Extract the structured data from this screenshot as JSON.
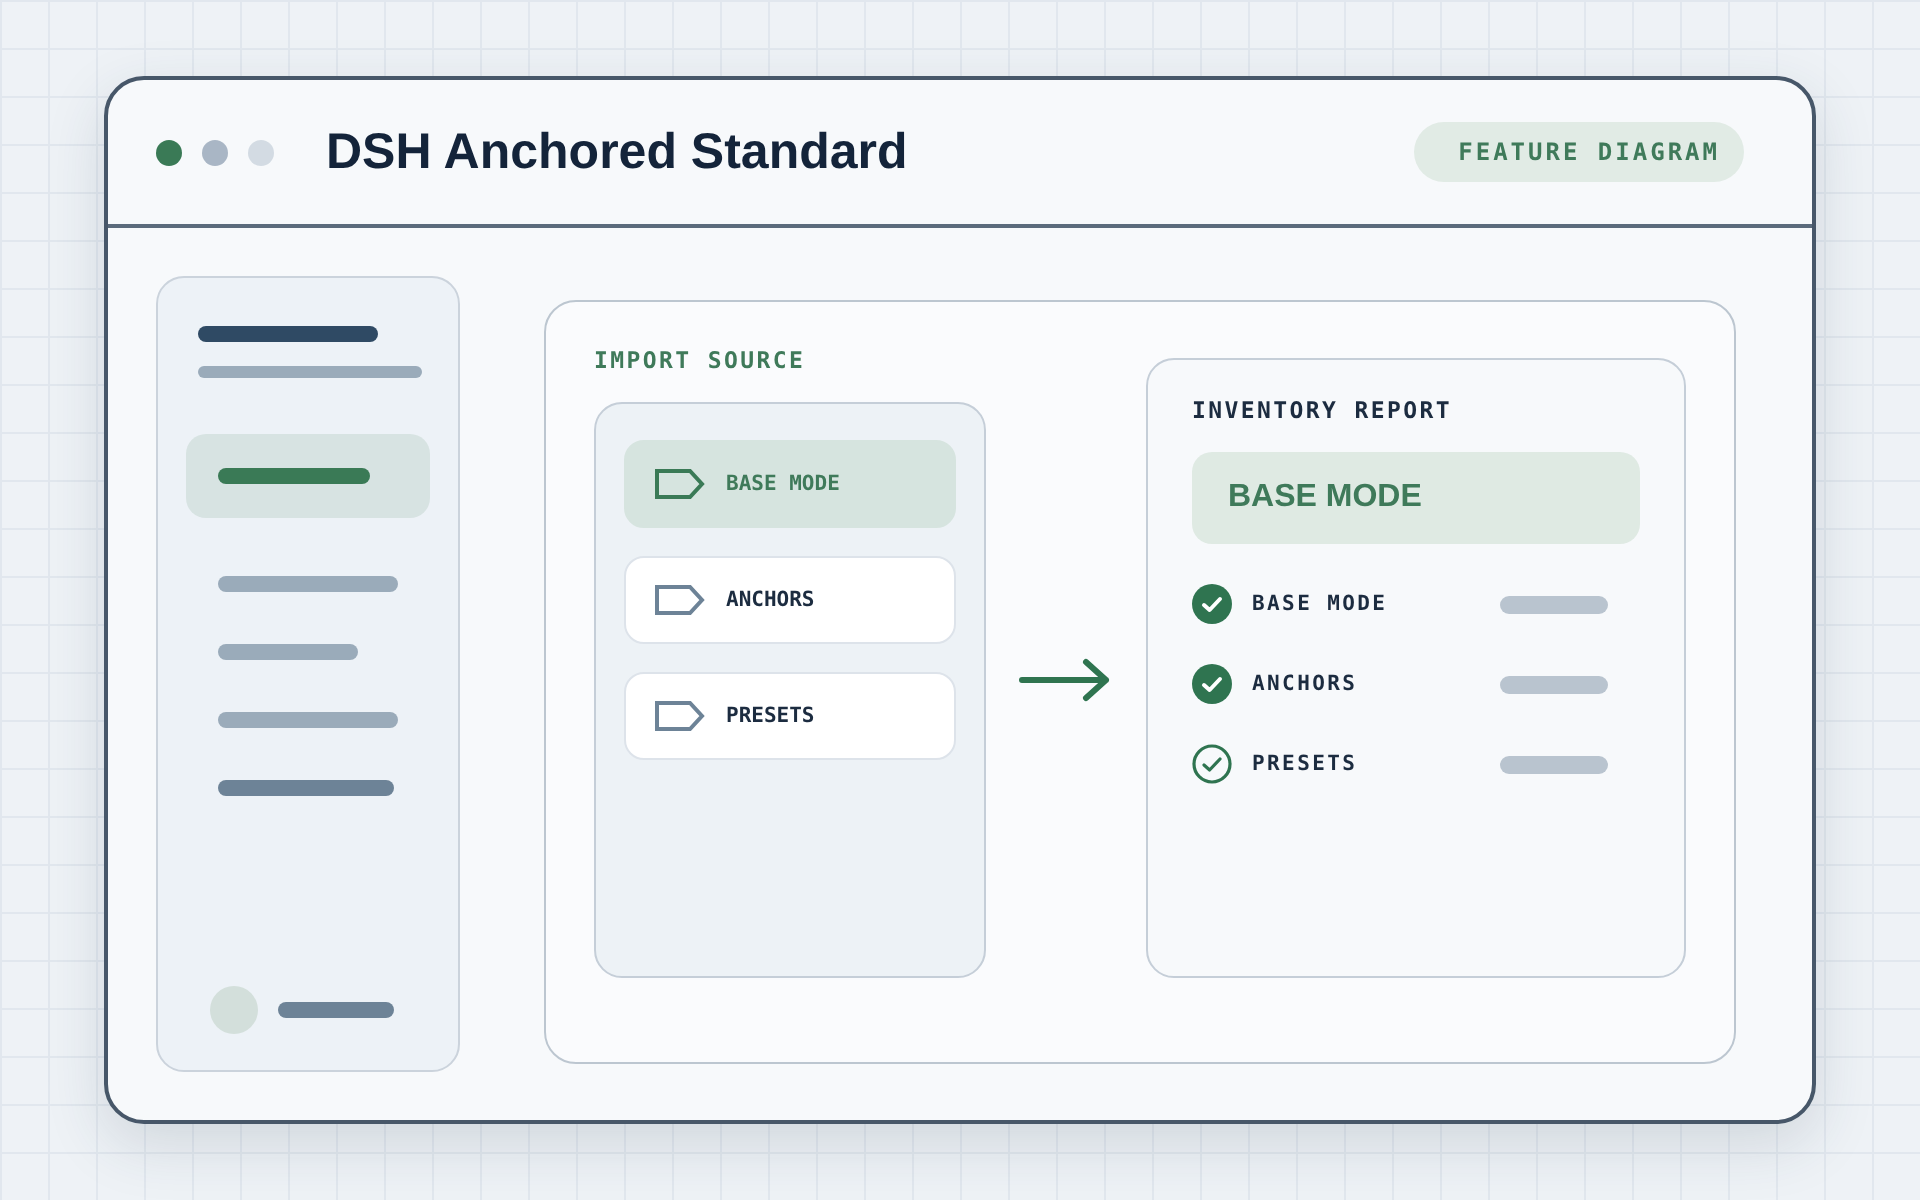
{
  "window": {
    "title": "DSH Anchored Standard",
    "badge": "FEATURE DIAGRAM"
  },
  "sidebar": {
    "items": [
      {
        "selected": true
      },
      {
        "selected": false
      },
      {
        "selected": false
      },
      {
        "selected": false
      },
      {
        "selected": false
      }
    ]
  },
  "import_source": {
    "title": "IMPORT SOURCE",
    "items": [
      {
        "label": "BASE MODE",
        "selected": true
      },
      {
        "label": "ANCHORS",
        "selected": false
      },
      {
        "label": "PRESETS",
        "selected": false
      }
    ]
  },
  "inventory_report": {
    "title": "INVENTORY REPORT",
    "highlight": "BASE MODE",
    "rows": [
      {
        "label": "BASE MODE",
        "done": true
      },
      {
        "label": "ANCHORS",
        "done": true
      },
      {
        "label": "PRESETS",
        "done": false
      }
    ]
  }
}
